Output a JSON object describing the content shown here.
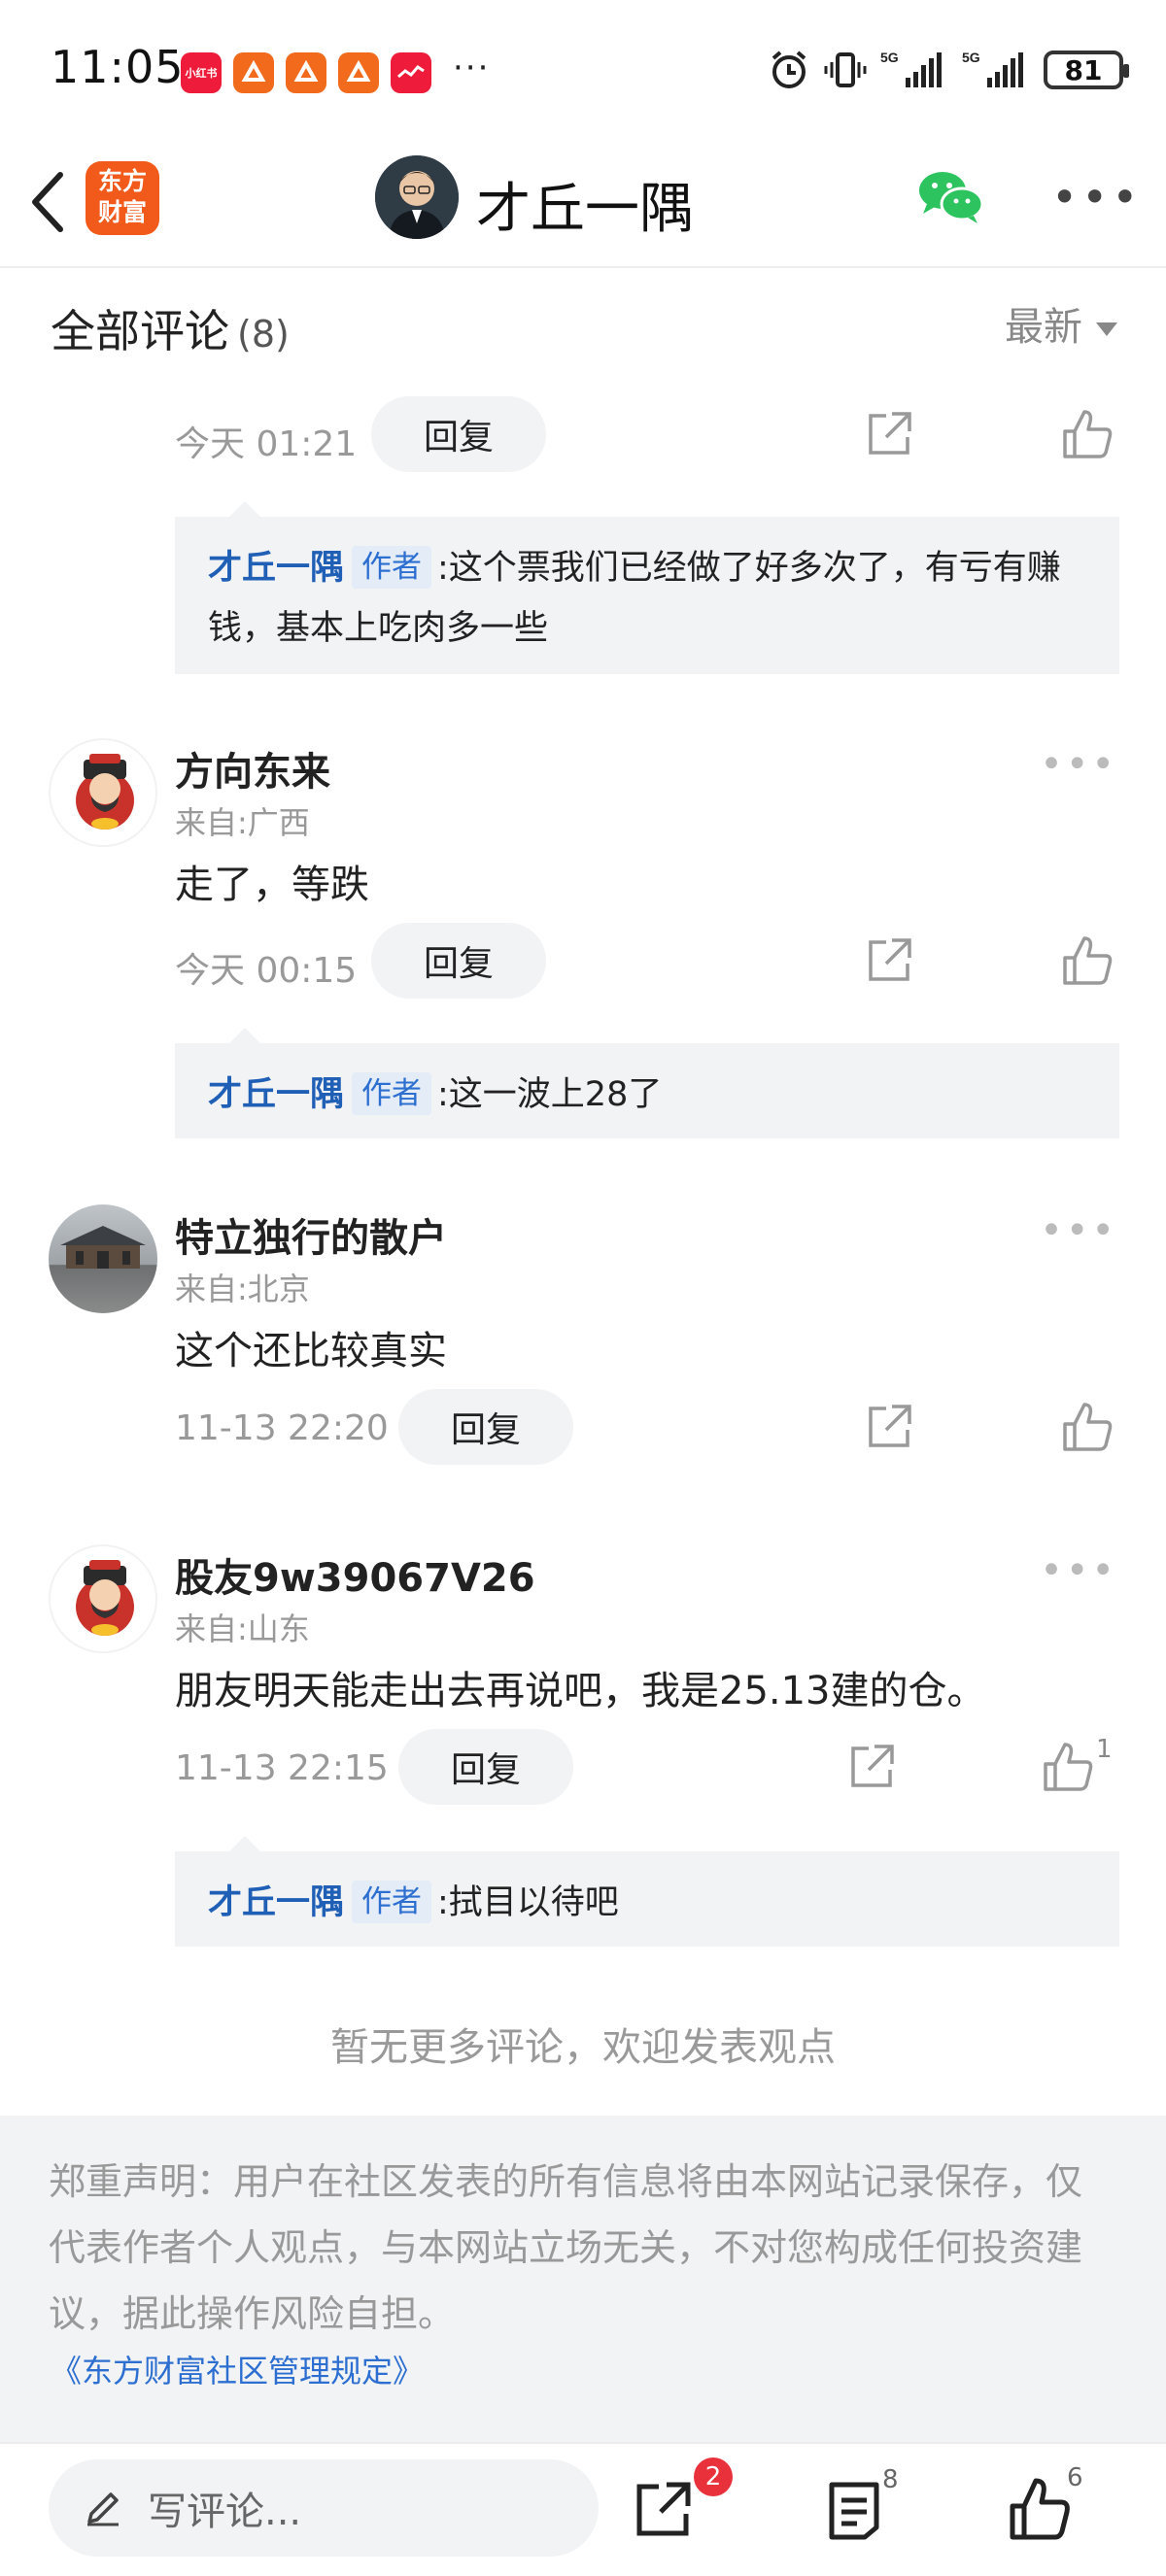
{
  "status_bar": {
    "time": "11:05",
    "app_icons": [
      "小红书",
      "",
      "",
      "",
      ""
    ],
    "more": "···",
    "battery": "81"
  },
  "header": {
    "logo_line1": "东方",
    "logo_line2": "财富",
    "title": "才丘一隅"
  },
  "comments_section": {
    "title": "全部评论",
    "count": "(8)",
    "sort_label": "最新"
  },
  "common": {
    "reply_button": "回复",
    "author_tag": "作者",
    "reply_author": "才丘一隅"
  },
  "comments": [
    {
      "time": "今天 01:21",
      "reply_text": ":这个票我们已经做了好多次了，有亏有赚钱，基本上吃肉多一些"
    },
    {
      "username": "方向东来",
      "location": "来自:广西",
      "text": "走了，等跌",
      "time": "今天 00:15",
      "reply_text": ":这一波上28了"
    },
    {
      "username": "特立独行的散户",
      "location": "来自:北京",
      "text": "这个还比较真实",
      "time": "11-13 22:20"
    },
    {
      "username": "股友9w39067V26",
      "location": "来自:山东",
      "text": "朋友明天能走出去再说吧，我是25.13建的仓。",
      "time": "11-13 22:15",
      "like_count": "1",
      "reply_text": ":拭目以待吧"
    }
  ],
  "no_more": "暂无更多评论，欢迎发表观点",
  "disclaimer": {
    "text": "郑重声明：用户在社区发表的所有信息将由本网站记录保存，仅代表作者个人观点，与本网站立场无关，不对您构成任何投资建议，据此操作风险自担。",
    "link": "《东方财富社区管理规定》"
  },
  "bottom_bar": {
    "placeholder": "写评论...",
    "share_badge": "2",
    "comment_count": "8",
    "like_count": "6"
  },
  "colors": {
    "accent_blue": "#2d6fd1",
    "brand_orange": "#f25a1b",
    "badge_red": "#e8313b"
  }
}
